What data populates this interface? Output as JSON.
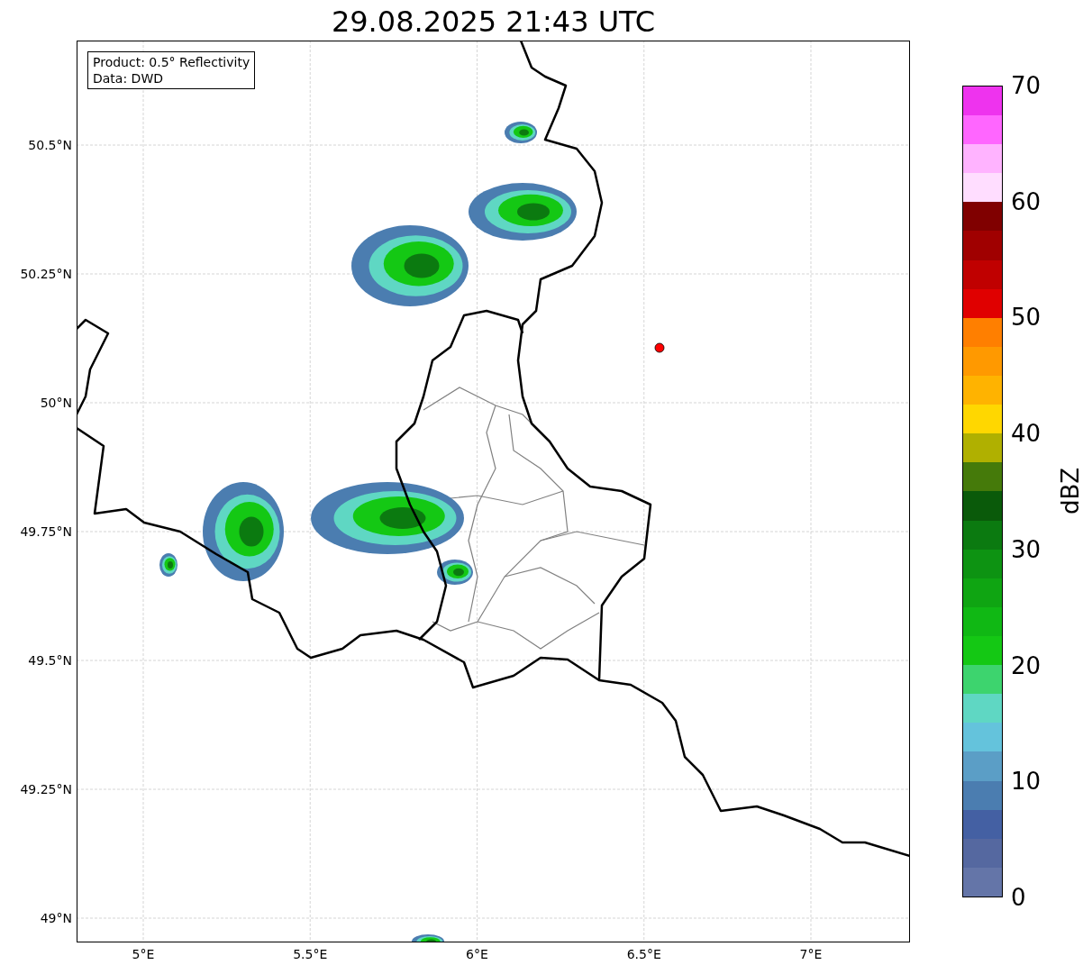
{
  "title": "29.08.2025 21:43 UTC",
  "info_box": {
    "lines": [
      "Product: 0.5° Reflectivity",
      "Data: DWD"
    ]
  },
  "map": {
    "y_ticks": [
      "50.5°N",
      "50.25°N",
      "50°N",
      "49.75°N",
      "49.5°N",
      "49.25°N",
      "49°N"
    ],
    "x_ticks": [
      "5°E",
      "5.5°E",
      "6°E",
      "6.5°E",
      "7°E"
    ]
  },
  "colorbar": {
    "label": "dBZ",
    "ticks": [
      "70",
      "60",
      "50",
      "40",
      "30",
      "20",
      "10",
      "0"
    ],
    "bands": [
      {
        "color": "#6475a8"
      },
      {
        "color": "#5568a0"
      },
      {
        "color": "#4460a3"
      },
      {
        "color": "#4b7db0"
      },
      {
        "color": "#5b9ec6"
      },
      {
        "color": "#64c3dc"
      },
      {
        "color": "#5fd7c3"
      },
      {
        "color": "#3dd46e"
      },
      {
        "color": "#14c814"
      },
      {
        "color": "#10b814"
      },
      {
        "color": "#0fa512"
      },
      {
        "color": "#0d9312"
      },
      {
        "color": "#0b7a10"
      },
      {
        "color": "#0a5a0a"
      },
      {
        "color": "#457a0a"
      },
      {
        "color": "#b0b000"
      },
      {
        "color": "#ffd700"
      },
      {
        "color": "#ffb300"
      },
      {
        "color": "#ff9900"
      },
      {
        "color": "#ff7f00"
      },
      {
        "color": "#e00000"
      },
      {
        "color": "#c00000"
      },
      {
        "color": "#a00000"
      },
      {
        "color": "#800000"
      },
      {
        "color": "#ffddff"
      },
      {
        "color": "#ffb3ff"
      },
      {
        "color": "#ff66ff"
      },
      {
        "color": "#ee33ee"
      }
    ]
  }
}
